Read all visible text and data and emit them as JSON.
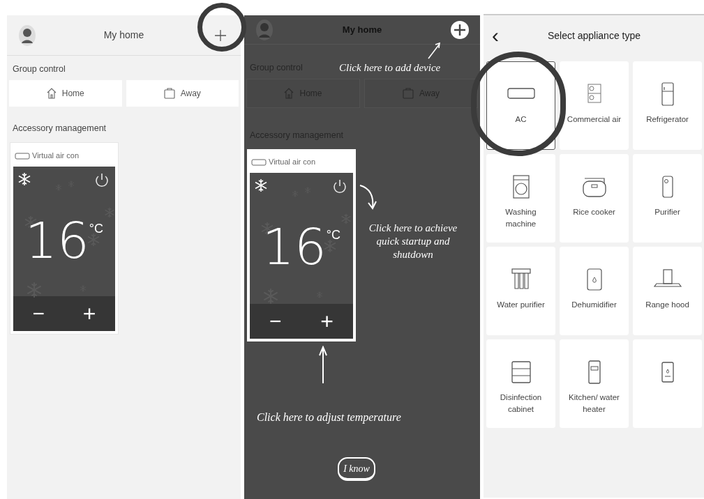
{
  "screens": [
    {
      "kind": "home",
      "header": {
        "title": "My home"
      },
      "group_label": "Group control",
      "group_buttons": [
        {
          "label": "Home"
        },
        {
          "label": "Away"
        }
      ],
      "accessory_label": "Accessory management",
      "card": {
        "name": "Virtual air con",
        "temperature": "16",
        "unit": "°C",
        "minus": "−",
        "plus": "+"
      }
    },
    {
      "kind": "guide",
      "header": {
        "title": "My home"
      },
      "group_label": "Group control",
      "group_buttons": [
        {
          "label": "Home"
        },
        {
          "label": "Away"
        }
      ],
      "accessory_label": "Accessory management",
      "card": {
        "name": "Virtual air con",
        "temperature": "16",
        "unit": "°C",
        "minus": "−",
        "plus": "+"
      },
      "hints": [
        {
          "kind": "add",
          "text": "Click here to add device"
        },
        {
          "kind": "power",
          "text": "Click here to achieve quick startup and shutdown"
        },
        {
          "kind": "temperature",
          "text": "Click here to adjust temperature"
        }
      ],
      "dismiss_button": "I know"
    },
    {
      "kind": "picker",
      "title": "Select appliance type",
      "back": "‹",
      "tiles": [
        {
          "label": "AC",
          "selected": true
        },
        {
          "label": "Commercial air",
          "selected": false
        },
        {
          "label": "Refrigerator",
          "selected": false
        },
        {
          "label": "Washing machine",
          "selected": false
        },
        {
          "label": "Rice cooker",
          "selected": false
        },
        {
          "label": "Purifier",
          "selected": false
        },
        {
          "label": "Water purifier",
          "selected": false
        },
        {
          "label": "Dehumidifier",
          "selected": false
        },
        {
          "label": "Range hood",
          "selected": false
        },
        {
          "label": "Disinfection cabinet",
          "selected": false
        },
        {
          "label": "Kitchen/ water heater",
          "selected": false
        },
        {
          "selected": false
        }
      ]
    }
  ]
}
